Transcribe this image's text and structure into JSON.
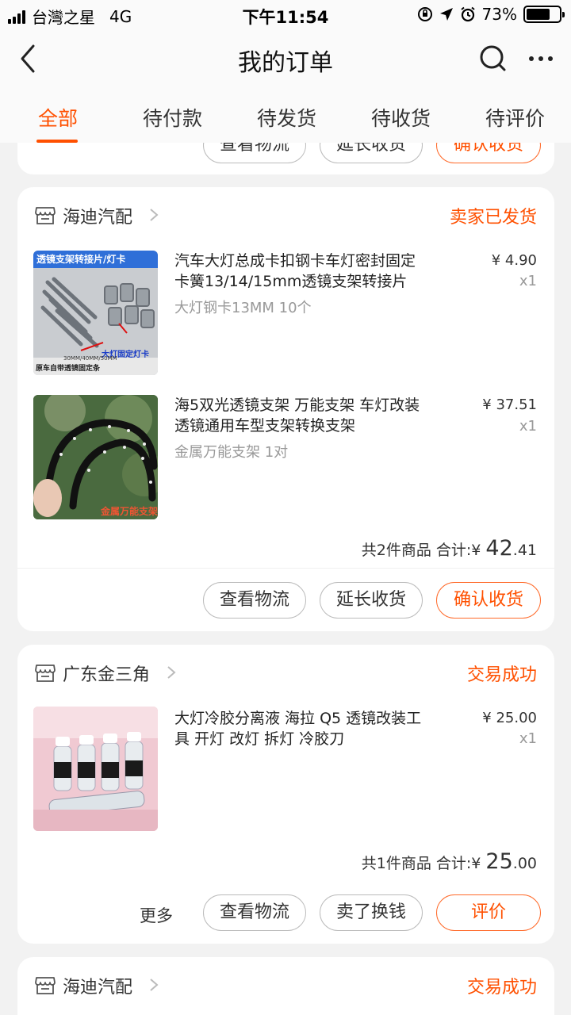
{
  "status_bar": {
    "carrier": "台灣之星",
    "network": "4G",
    "time": "下午11:54",
    "battery": "73%",
    "battery_level": 0.73
  },
  "nav": {
    "title": "我的订单"
  },
  "tabs": [
    {
      "label": "全部",
      "active": true
    },
    {
      "label": "待付款",
      "active": false
    },
    {
      "label": "待发货",
      "active": false
    },
    {
      "label": "待收货",
      "active": false
    },
    {
      "label": "待评价",
      "active": false
    }
  ],
  "colors": {
    "accent": "#ff5000",
    "background": "#f2f2f2",
    "card": "#ffffff",
    "muted_text": "#999999"
  },
  "top_card_partial": {
    "buttons": [
      "查看物流",
      "延长收货",
      "确认收货"
    ]
  },
  "orders": [
    {
      "shop": "海迪汽配",
      "status": "卖家已发货",
      "items": [
        {
          "title": "汽车大灯总成卡扣钢卡车灯密封固定卡簧13/14/15mm透镜支架转接片",
          "title_line1": "汽车大灯总成卡扣钢卡车灯密封固定",
          "title_line2": "卡簧13/14/15mm透镜支架转接片",
          "spec": "大灯钢卡13MM   10个",
          "price": "¥ 4.90",
          "qty": "x1",
          "thumb_caption_top": "透镜支架转接片/灯卡",
          "thumb_caption_mid": "大灯固定灯卡",
          "thumb_caption_bottom": "原车自带透镜固定条",
          "thumb_caption_size": "30MM/40MM/50MM"
        },
        {
          "title": "海5双光透镜支架 万能支架 车灯改装透镜通用车型支架转换支架",
          "title_line1": "海5双光透镜支架 万能支架 车灯改装",
          "title_line2": "透镜通用车型支架转换支架",
          "spec": "金属万能支架 1对",
          "price": "¥ 37.51",
          "qty": "x1",
          "thumb_caption_bottom": "金属万能支架"
        }
      ],
      "summary_count": "共2件商品",
      "summary_label": "合计:",
      "summary_currency": "¥ ",
      "summary_int": "42",
      "summary_dec": ".41",
      "buttons": [
        "查看物流",
        "延长收货",
        "确认收货"
      ]
    },
    {
      "shop": "广东金三角",
      "status": "交易成功",
      "items": [
        {
          "title": "大灯冷胶分离液 海拉 Q5 透镜改装工具 开灯 改灯 拆灯 冷胶刀",
          "title_line1": "大灯冷胶分离液 海拉 Q5 透镜改装工",
          "title_line2": "具 开灯 改灯 拆灯 冷胶刀",
          "spec": "",
          "price": "¥ 25.00",
          "qty": "x1"
        }
      ],
      "summary_count": "共1件商品",
      "summary_label": "合计:",
      "summary_currency": "¥ ",
      "summary_int": "25",
      "summary_dec": ".00",
      "more_label": "更多",
      "buttons": [
        "查看物流",
        "卖了换钱",
        "评价"
      ]
    },
    {
      "shop": "海迪汽配",
      "status": "交易成功"
    }
  ]
}
